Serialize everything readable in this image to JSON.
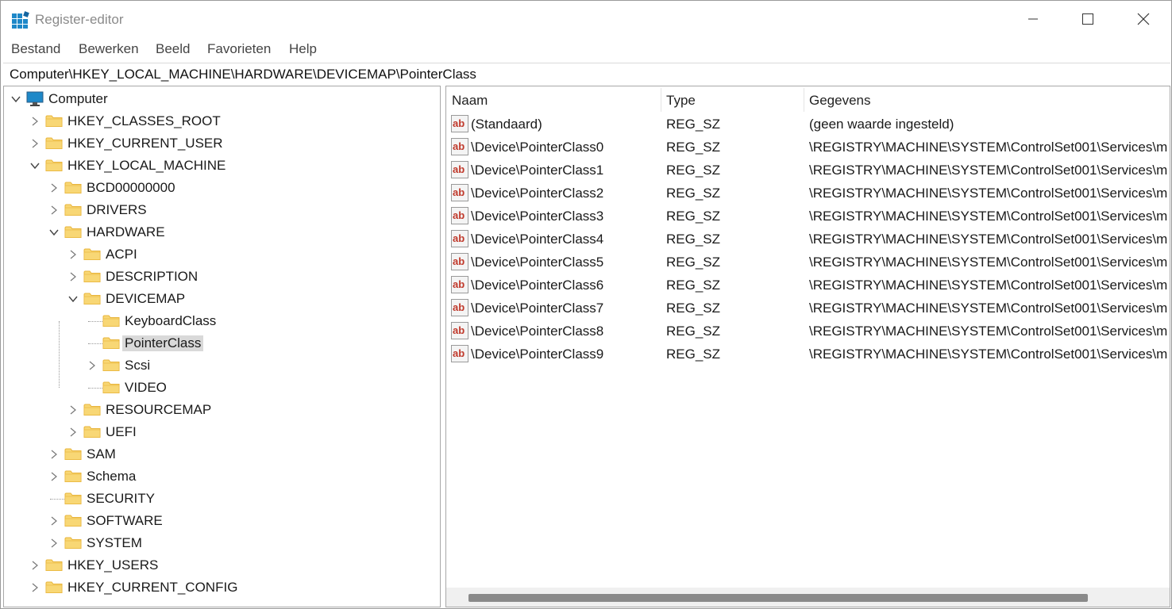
{
  "window": {
    "title": "Register-editor"
  },
  "menu": [
    "Bestand",
    "Bewerken",
    "Beeld",
    "Favorieten",
    "Help"
  ],
  "address": "Computer\\HKEY_LOCAL_MACHINE\\HARDWARE\\DEVICEMAP\\PointerClass",
  "tree": [
    {
      "label": "Computer",
      "icon": "computer-icon",
      "toggle": "expanded"
    },
    {
      "label": "HKEY_CLASSES_ROOT",
      "icon": "folder-icon",
      "toggle": "collapsed"
    },
    {
      "label": "HKEY_CURRENT_USER",
      "icon": "folder-icon",
      "toggle": "collapsed"
    },
    {
      "label": "HKEY_LOCAL_MACHINE",
      "icon": "folder-icon",
      "toggle": "expanded"
    },
    {
      "label": "BCD00000000",
      "icon": "folder-icon",
      "toggle": "collapsed"
    },
    {
      "label": "DRIVERS",
      "icon": "folder-icon",
      "toggle": "collapsed"
    },
    {
      "label": "HARDWARE",
      "icon": "folder-icon",
      "toggle": "expanded"
    },
    {
      "label": "ACPI",
      "icon": "folder-icon",
      "toggle": "collapsed"
    },
    {
      "label": "DESCRIPTION",
      "icon": "folder-icon",
      "toggle": "collapsed"
    },
    {
      "label": "DEVICEMAP",
      "icon": "folder-icon",
      "toggle": "expanded"
    },
    {
      "label": "KeyboardClass",
      "icon": "folder-icon",
      "toggle": "none"
    },
    {
      "label": "PointerClass",
      "icon": "folder-icon",
      "toggle": "none",
      "selected": true
    },
    {
      "label": "Scsi",
      "icon": "folder-icon",
      "toggle": "collapsed"
    },
    {
      "label": "VIDEO",
      "icon": "folder-icon",
      "toggle": "none"
    },
    {
      "label": "RESOURCEMAP",
      "icon": "folder-icon",
      "toggle": "collapsed"
    },
    {
      "label": "UEFI",
      "icon": "folder-icon",
      "toggle": "collapsed"
    },
    {
      "label": "SAM",
      "icon": "folder-icon",
      "toggle": "collapsed"
    },
    {
      "label": "Schema",
      "icon": "folder-icon",
      "toggle": "collapsed"
    },
    {
      "label": "SECURITY",
      "icon": "folder-icon",
      "toggle": "none"
    },
    {
      "label": "SOFTWARE",
      "icon": "folder-icon",
      "toggle": "collapsed"
    },
    {
      "label": "SYSTEM",
      "icon": "folder-icon",
      "toggle": "collapsed"
    },
    {
      "label": "HKEY_USERS",
      "icon": "folder-icon",
      "toggle": "collapsed"
    },
    {
      "label": "HKEY_CURRENT_CONFIG",
      "icon": "folder-icon",
      "toggle": "collapsed"
    }
  ],
  "columns": [
    "Naam",
    "Type",
    "Gegevens"
  ],
  "values": [
    {
      "name": "(Standaard)",
      "type": "REG_SZ",
      "data": "(geen waarde ingesteld)"
    },
    {
      "name": "\\Device\\PointerClass0",
      "type": "REG_SZ",
      "data": "\\REGISTRY\\MACHINE\\SYSTEM\\ControlSet001\\Services\\m"
    },
    {
      "name": "\\Device\\PointerClass1",
      "type": "REG_SZ",
      "data": "\\REGISTRY\\MACHINE\\SYSTEM\\ControlSet001\\Services\\m"
    },
    {
      "name": "\\Device\\PointerClass2",
      "type": "REG_SZ",
      "data": "\\REGISTRY\\MACHINE\\SYSTEM\\ControlSet001\\Services\\m"
    },
    {
      "name": "\\Device\\PointerClass3",
      "type": "REG_SZ",
      "data": "\\REGISTRY\\MACHINE\\SYSTEM\\ControlSet001\\Services\\m"
    },
    {
      "name": "\\Device\\PointerClass4",
      "type": "REG_SZ",
      "data": "\\REGISTRY\\MACHINE\\SYSTEM\\ControlSet001\\Services\\m"
    },
    {
      "name": "\\Device\\PointerClass5",
      "type": "REG_SZ",
      "data": "\\REGISTRY\\MACHINE\\SYSTEM\\ControlSet001\\Services\\m"
    },
    {
      "name": "\\Device\\PointerClass6",
      "type": "REG_SZ",
      "data": "\\REGISTRY\\MACHINE\\SYSTEM\\ControlSet001\\Services\\m"
    },
    {
      "name": "\\Device\\PointerClass7",
      "type": "REG_SZ",
      "data": "\\REGISTRY\\MACHINE\\SYSTEM\\ControlSet001\\Services\\m"
    },
    {
      "name": "\\Device\\PointerClass8",
      "type": "REG_SZ",
      "data": "\\REGISTRY\\MACHINE\\SYSTEM\\ControlSet001\\Services\\m"
    },
    {
      "name": "\\Device\\PointerClass9",
      "type": "REG_SZ",
      "data": "\\REGISTRY\\MACHINE\\SYSTEM\\ControlSet001\\Services\\m"
    }
  ],
  "colors": {
    "folder": "#f8d775",
    "folder_dark": "#e8b43a",
    "selection": "#d9d9d9",
    "ab_icon_red": "#c0392b",
    "monitor_blue": "#1e88c8"
  }
}
